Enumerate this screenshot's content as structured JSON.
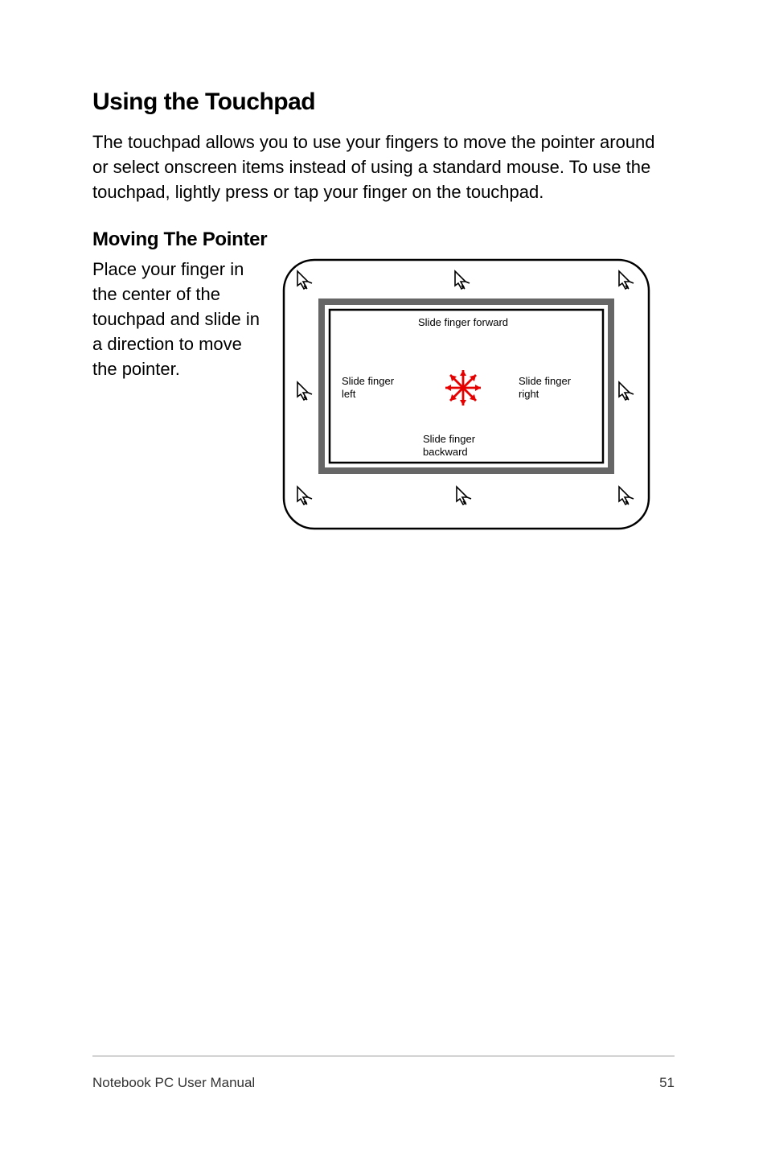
{
  "heading1": "Using the Touchpad",
  "intro": "The touchpad allows you to use your fingers to move the pointer around or select onscreen items instead of using a standard mouse. To use the touchpad, lightly press or tap your finger on the touchpad.",
  "heading2": "Moving The Pointer",
  "sidetext": "Place your finger in the center of the touchpad and slide in a direction to move the pointer.",
  "diagram": {
    "forward": "Slide finger forward",
    "backward": "Slide finger backward",
    "left1": "Slide finger",
    "left2": "left",
    "right1": "Slide finger",
    "right2": "right"
  },
  "footer": {
    "left": "Notebook PC User Manual",
    "right": "51"
  }
}
